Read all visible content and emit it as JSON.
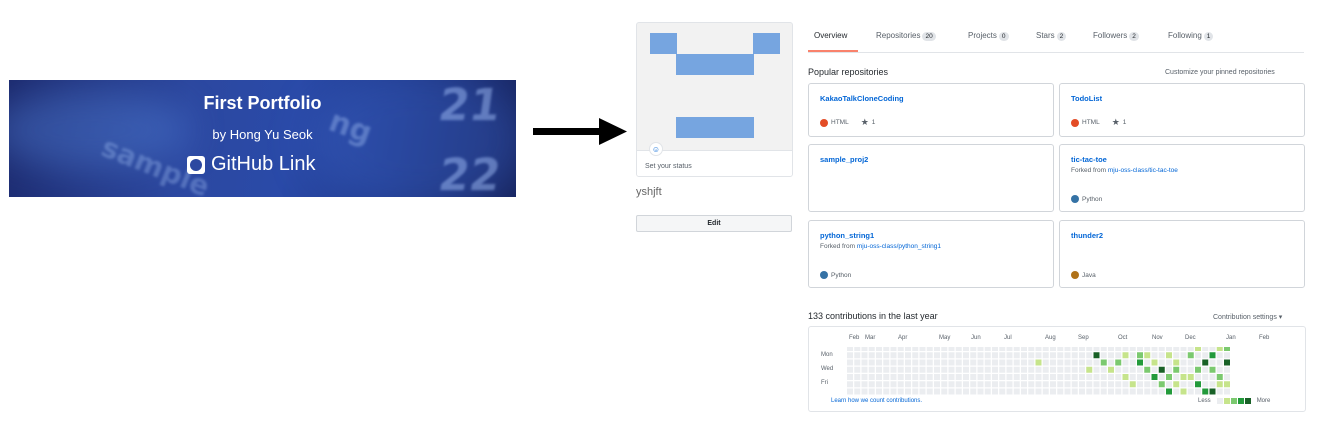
{
  "banner": {
    "title": "First Portfolio",
    "subtitle": "by Hong Yu Seok",
    "link_label": "GitHub Link"
  },
  "profile": {
    "status_placeholder": "Set your status",
    "username": "yshjft",
    "edit_label": "Edit"
  },
  "tabs": [
    {
      "label": "Overview",
      "count": null,
      "active": true
    },
    {
      "label": "Repositories",
      "count": "20",
      "active": false
    },
    {
      "label": "Projects",
      "count": "0",
      "active": false
    },
    {
      "label": "Stars",
      "count": "2",
      "active": false
    },
    {
      "label": "Followers",
      "count": "2",
      "active": false
    },
    {
      "label": "Following",
      "count": "1",
      "active": false
    }
  ],
  "popular": {
    "title": "Popular repositories",
    "customize_link": "Customize your pinned repositories",
    "repos": [
      {
        "name": "KakaoTalkCloneCoding",
        "fork_prefix": "",
        "fork_source": "",
        "language": "HTML",
        "lang_color": "#e34c26",
        "stars": "1"
      },
      {
        "name": "TodoList",
        "fork_prefix": "",
        "fork_source": "",
        "language": "HTML",
        "lang_color": "#e34c26",
        "stars": "1"
      },
      {
        "name": "sample_proj2",
        "fork_prefix": "",
        "fork_source": "",
        "language": "",
        "lang_color": "",
        "stars": ""
      },
      {
        "name": "tic-tac-toe",
        "fork_prefix": "Forked from ",
        "fork_source": "mju-oss-class/tic-tac-toe",
        "language": "Python",
        "lang_color": "#3572A5",
        "stars": ""
      },
      {
        "name": "python_string1",
        "fork_prefix": "Forked from ",
        "fork_source": "mju-oss-class/python_string1",
        "language": "Python",
        "lang_color": "#3572A5",
        "stars": ""
      },
      {
        "name": "thunder2",
        "fork_prefix": "",
        "fork_source": "",
        "language": "Java",
        "lang_color": "#b07219",
        "stars": ""
      }
    ]
  },
  "contributions": {
    "title": "133 contributions in the last year",
    "settings_label": "Contribution settings ▾",
    "months": [
      "Feb",
      "Mar",
      "Apr",
      "May",
      "Jun",
      "Jul",
      "Aug",
      "Sep",
      "Oct",
      "Nov",
      "Dec",
      "Jan",
      "Feb"
    ],
    "days": [
      "Mon",
      "Wed",
      "Fri"
    ],
    "learn_link": "Learn how we count contributions.",
    "legend_less": "Less",
    "legend_more": "More",
    "colors": [
      "#ebedf0",
      "#c6e48b",
      "#7bc96f",
      "#239a3b",
      "#196127"
    ]
  }
}
